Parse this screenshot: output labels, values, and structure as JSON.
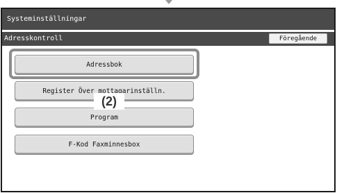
{
  "header": {
    "title": "Systeminställningar"
  },
  "subheader": {
    "title": "Adresskontroll",
    "back_label": "Föregående"
  },
  "menu": {
    "items": [
      {
        "label": "Adressbok"
      },
      {
        "label": "Register Över mottagarinställn."
      },
      {
        "label": "Program"
      },
      {
        "label": "F-Kod Faxminnesbox"
      }
    ]
  },
  "annotation": {
    "callout_label": "(2)"
  }
}
